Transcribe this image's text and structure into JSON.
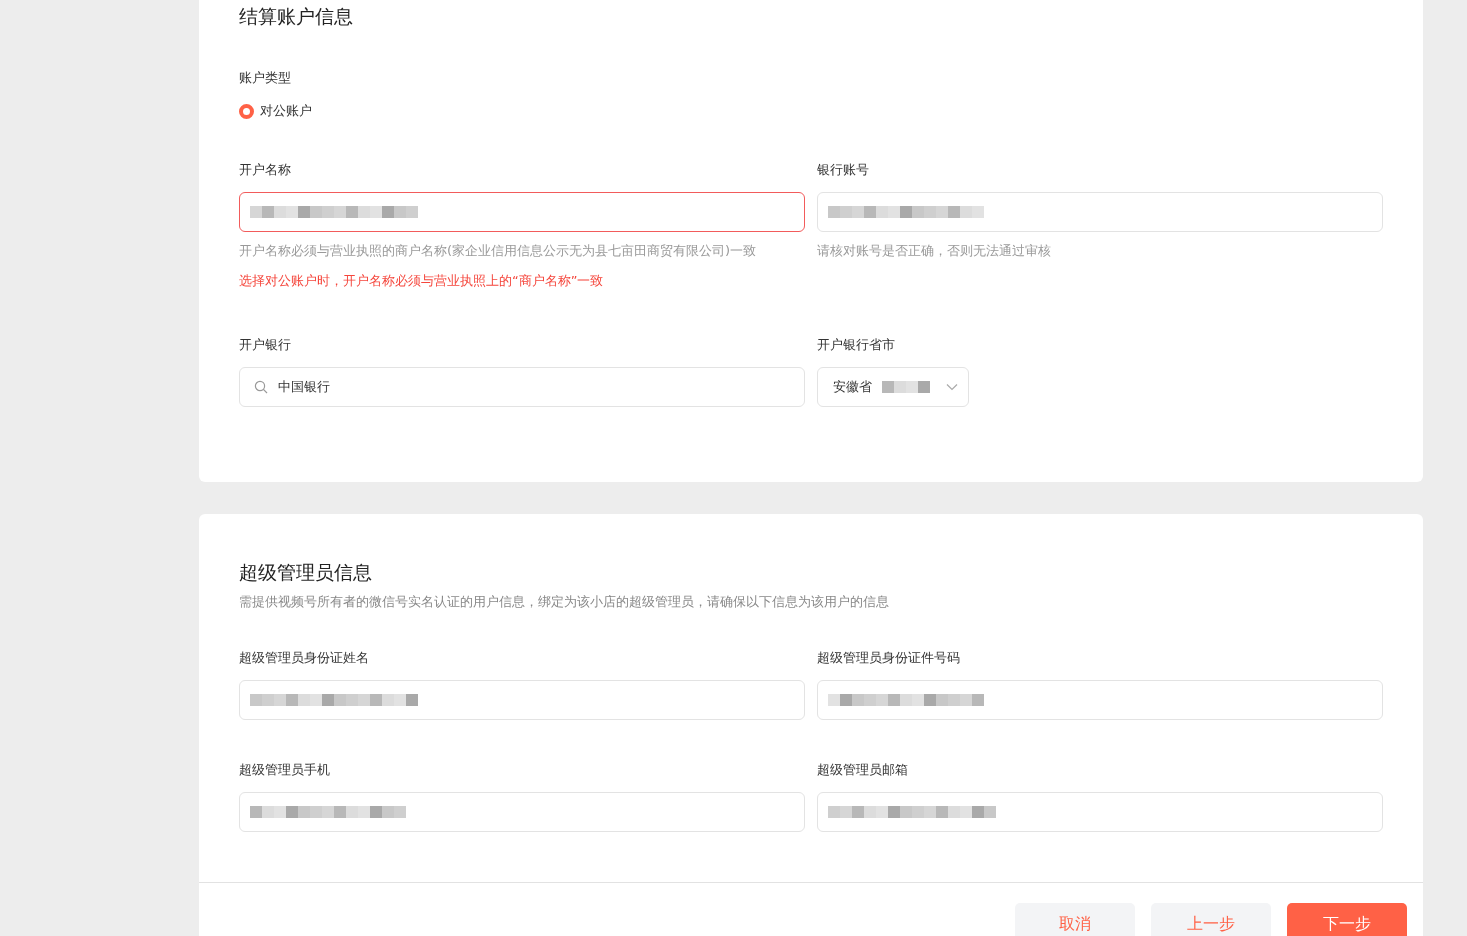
{
  "settlement": {
    "title": "结算账户信息",
    "account_type": {
      "label": "账户类型",
      "options": [
        {
          "label": "对公账户",
          "selected": true
        }
      ]
    },
    "rows": [
      [
        {
          "label": "开户名称",
          "kind": "text",
          "error": true,
          "masked": true,
          "hints": [
            {
              "text": "开户名称必须与营业执照的商户名称(家企业信用信息公示无为县七亩田商贸有限公司)一致",
              "kind": "note"
            },
            {
              "text": "选择对公账户时，开户名称必须与营业执照上的“商户名称”一致",
              "kind": "error"
            }
          ]
        },
        {
          "label": "银行账号",
          "kind": "text",
          "error": false,
          "masked": true,
          "hints": [
            {
              "text": "请核对账号是否正确，否则无法通过审核",
              "kind": "note"
            }
          ]
        }
      ],
      [
        {
          "label": "开户银行",
          "kind": "search",
          "error": false,
          "value": "中国银行"
        },
        {
          "label": "开户银行省市",
          "kind": "select",
          "error": false,
          "value": "安徽省",
          "masked": true
        }
      ]
    ]
  },
  "admin": {
    "title": "超级管理员信息",
    "description": "需提供视频号所有者的微信号实名认证的用户信息，绑定为该小店的超级管理员，请确保以下信息为该用户的信息",
    "rows": [
      [
        {
          "label": "超级管理员身份证姓名",
          "kind": "text",
          "error": false,
          "masked": true
        },
        {
          "label": "超级管理员身份证件号码",
          "kind": "text",
          "error": false,
          "masked": true
        }
      ],
      [
        {
          "label": "超级管理员手机",
          "kind": "text",
          "error": false,
          "masked": true
        },
        {
          "label": "超级管理员邮箱",
          "kind": "text",
          "error": false,
          "masked": true
        }
      ]
    ]
  },
  "footer": {
    "buttons": [
      {
        "label": "取消",
        "kind": "secondary"
      },
      {
        "label": "上一步",
        "kind": "secondary"
      },
      {
        "label": "下一步",
        "kind": "primary"
      }
    ]
  }
}
